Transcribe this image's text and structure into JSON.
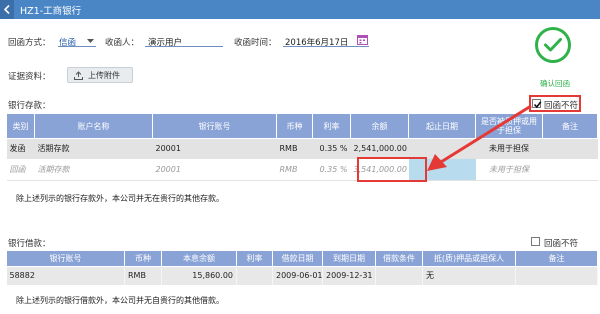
{
  "window": {
    "title": "HZ1-工商银行"
  },
  "form": {
    "reply_method_label": "回函方式：",
    "reply_method_value": "信函",
    "recipient_label": "收函人：",
    "recipient_value": "演示用户",
    "receive_time_label": "收函时间：",
    "receive_time_value": "2016年6月17日",
    "evidence_label": "证据资料：",
    "upload_label": "上传附件"
  },
  "seal": {
    "label": "确认回函",
    "color": "#2fb24a"
  },
  "deposits": {
    "section_title": "银行存款：",
    "mismatch_label": "回函不符",
    "mismatch_checked": true,
    "columns": [
      "类别",
      "账户名称",
      "银行账号",
      "币种",
      "利率",
      "余额",
      "起止日期",
      "是否被质押或用于担保",
      "备注"
    ],
    "rows": [
      {
        "category": "发函",
        "account_name": "活期存款",
        "account_no": "20001",
        "currency": "RMB",
        "rate": "0.35 %",
        "balance": "2,541,000.00",
        "date_range": "",
        "pledged": "未用于担保",
        "remark": ""
      },
      {
        "category": "回函",
        "account_name": "活期存款",
        "account_no": "20001",
        "currency": "RMB",
        "rate": "0.35 %",
        "balance": "3,541,000.00",
        "date_range": "",
        "pledged": "未用于担保",
        "remark": ""
      }
    ],
    "note": "除上述列示的银行存款外，本公司并无在贵行的其他存款。"
  },
  "loans": {
    "section_title": "银行借款：",
    "mismatch_label": "回函不符",
    "mismatch_checked": false,
    "columns": [
      "银行账号",
      "币种",
      "本息余额",
      "利率",
      "借款日期",
      "到期日期",
      "借款条件",
      "抵(质)押品或担保人",
      "备注"
    ],
    "rows": [
      {
        "account_no": "58882",
        "currency": "RMB",
        "balance": "15,860.00",
        "rate": "",
        "loan_date": "2009-06-01",
        "due_date": "2009-12-31",
        "conditions": "",
        "collateral": "无",
        "remark": ""
      }
    ],
    "note": "除上述列示的银行借款外，本公司并无自贵行的其他借款。"
  },
  "colors": {
    "title_bar": "#4a86c5",
    "table_header": "#8aa3d6",
    "highlight": "#e53935",
    "accent_blue": "#1f58a8"
  }
}
